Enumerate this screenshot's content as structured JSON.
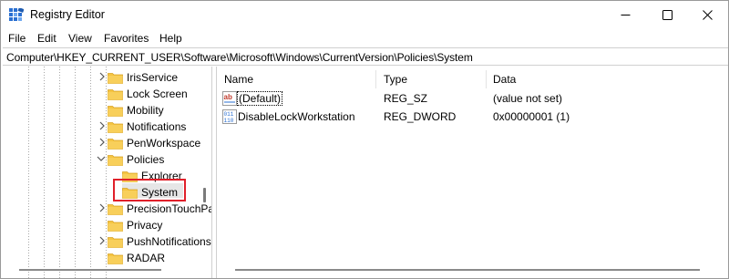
{
  "window": {
    "title": "Registry Editor",
    "controls": {
      "minimize": "minimize-icon",
      "maximize": "maximize-icon",
      "close": "close-icon"
    }
  },
  "menu": [
    "File",
    "Edit",
    "View",
    "Favorites",
    "Help"
  ],
  "address": "Computer\\HKEY_CURRENT_USER\\Software\\Microsoft\\Windows\\CurrentVersion\\Policies\\System",
  "tree": {
    "items": [
      {
        "label": "IrisService",
        "expandable": true,
        "expanded": false
      },
      {
        "label": "Lock Screen",
        "expandable": false
      },
      {
        "label": "Mobility",
        "expandable": false
      },
      {
        "label": "Notifications",
        "expandable": true,
        "expanded": false
      },
      {
        "label": "PenWorkspace",
        "expandable": true,
        "expanded": false
      },
      {
        "label": "Policies",
        "expandable": true,
        "expanded": true
      },
      {
        "label": "Explorer",
        "expandable": false
      },
      {
        "label": "System",
        "expandable": false,
        "selected": true
      },
      {
        "label": "PrecisionTouchPad",
        "expandable": true,
        "expanded": false
      },
      {
        "label": "Privacy",
        "expandable": false
      },
      {
        "label": "PushNotifications",
        "expandable": true,
        "expanded": false
      },
      {
        "label": "RADAR",
        "expandable": false
      }
    ]
  },
  "list": {
    "columns": [
      "Name",
      "Type",
      "Data"
    ],
    "rows": [
      {
        "name": "(Default)",
        "type": "REG_SZ",
        "data": "(value not set)",
        "icon": "string-value-icon"
      },
      {
        "name": "DisableLockWorkstation",
        "type": "REG_DWORD",
        "data": "0x00000001 (1)",
        "icon": "binary-value-icon"
      }
    ]
  },
  "colors": {
    "folder": "#f5c542",
    "folder_dark": "#e0a82a",
    "highlight_border": "#e0202a",
    "selection": "#e6e6e6"
  }
}
